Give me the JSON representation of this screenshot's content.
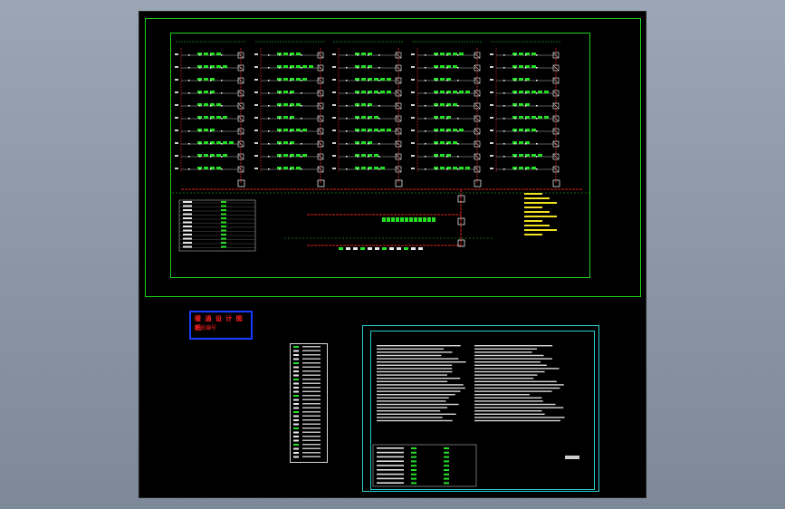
{
  "window": {
    "title": ""
  },
  "stamp": {
    "line1": "暖 通 设 计 图 纸",
    "line2": "图纸编号",
    "line3": ""
  },
  "drawing_title": "",
  "notes_title": "",
  "colors": {
    "background": "#8b97a6",
    "canvas": "#000000",
    "frame_green": "#20d020",
    "pipe_red": "#e02020",
    "node_white": "#ffffff",
    "stamp_blue": "#1a3cff",
    "notes_cyan": "#2ad0d0",
    "legend_yellow": "#f0e020"
  }
}
